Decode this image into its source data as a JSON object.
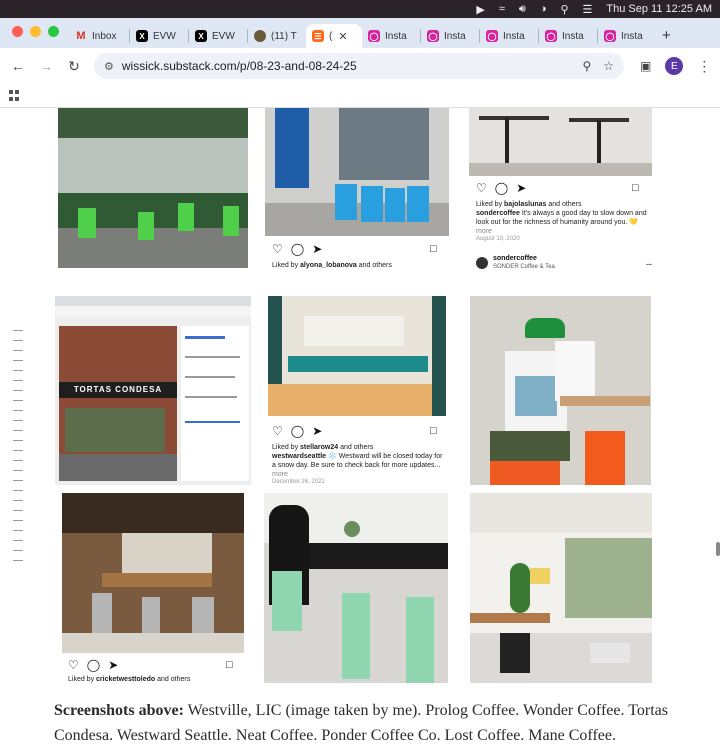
{
  "system": {
    "datetime": "Thu Sep 11  12:25 AM",
    "icons": [
      "play-circle-icon",
      "wifi-icon",
      "volume-icon",
      "switch-icon",
      "search-icon",
      "control-center-icon"
    ]
  },
  "browser": {
    "tabs": [
      {
        "label": "Inbox",
        "icon": "gmail-icon",
        "color": "#d93025"
      },
      {
        "label": "EVW",
        "icon": "x-icon",
        "color": "#000000"
      },
      {
        "label": "EVW",
        "icon": "x-icon",
        "color": "#000000"
      },
      {
        "label": "(11) T",
        "icon": "threads-icon",
        "color": "#6b5a3a"
      },
      {
        "label": "(",
        "icon": "substack-icon",
        "color": "#ff6719",
        "active": true
      },
      {
        "label": "Insta",
        "icon": "instagram-icon",
        "color": "#d6249f"
      },
      {
        "label": "Insta",
        "icon": "instagram-icon",
        "color": "#d6249f"
      },
      {
        "label": "Insta",
        "icon": "instagram-icon",
        "color": "#d6249f"
      },
      {
        "label": "Insta",
        "icon": "instagram-icon",
        "color": "#d6249f"
      },
      {
        "label": "Insta",
        "icon": "instagram-icon",
        "color": "#d6249f"
      }
    ],
    "new_tab": "+",
    "url": "wissick.substack.com/p/08-23-and-08-24-25",
    "profile_initial": "E"
  },
  "posts": {
    "p3": {
      "liked_by": "bajolaslunas",
      "caption_user": "sondercoffee",
      "caption": "It's always a good day to slow down and look out for the richness of humanity around you. 💛",
      "more": "more",
      "date": "August 10, 2020"
    },
    "p2": {
      "liked_by": "alyona_lobanova"
    },
    "p5": {
      "liked_by": "stellarow24",
      "caption_user": "westwardseattle",
      "caption": "❄️ Westward will be closed today for a snow day. Be sure to check back for more updates...",
      "more": "more",
      "date": "December 26, 2021"
    },
    "p6": {
      "user": "sondercoffee",
      "subtitle": "SONDER Coffee & Tea",
      "menu": "..."
    },
    "p4": {
      "sign": "TORTAS CONDESA"
    },
    "p7": {
      "liked_by": "cricketwesttoledo"
    }
  },
  "labels": {
    "liked_by_prefix": "Liked by ",
    "and_others": " and others"
  },
  "caption": {
    "lead": "Screenshots above:",
    "body": " Westville, LIC (image taken by me). Prolog Coffee. Wonder Coffee. Tortas Condesa. Westward Seattle. Neat Coffee. Ponder Coffee Co. Lost Coffee. Mane Coffee."
  }
}
